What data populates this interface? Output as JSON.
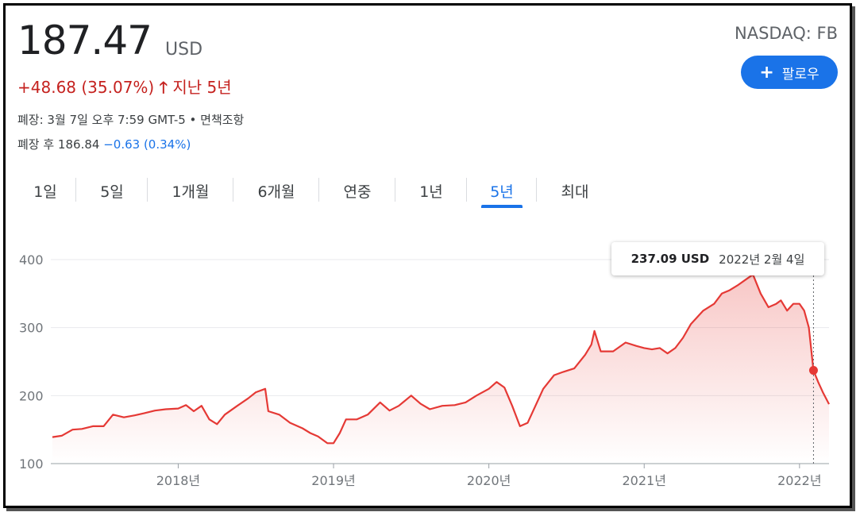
{
  "quote": {
    "price": "187.47",
    "currency": "USD",
    "change": "+48.68 (35.07%)",
    "change_arrow": "🡑",
    "change_period": "지난 5년",
    "closed_info": "폐장: 3월 7일 오후 7:59 GMT-5 • 면책조항",
    "after_label": "폐장 후 186.84",
    "after_change": "−0.63 (0.34%)",
    "ticker": "NASDAQ: FB",
    "follow_icon": "+",
    "follow_label": "팔로우"
  },
  "tabs": [
    "1일",
    "5일",
    "1개월",
    "6개월",
    "연중",
    "1년",
    "5년",
    "최대"
  ],
  "active_tab": "5년",
  "tooltip": {
    "value": "237.09 USD",
    "date": "2022년 2월 4일"
  },
  "colors": {
    "line": "#e53935",
    "accent": "#1a73e8",
    "negative": "#c5221f"
  },
  "chart_data": {
    "type": "area",
    "title": "",
    "xlabel": "",
    "ylabel": "",
    "ylim": [
      100,
      400
    ],
    "yticks": [
      100,
      200,
      300,
      400
    ],
    "xticks": [
      {
        "x": 2018.0,
        "label": "2018년"
      },
      {
        "x": 2019.0,
        "label": "2019년"
      },
      {
        "x": 2020.0,
        "label": "2020년"
      },
      {
        "x": 2021.0,
        "label": "2021년"
      },
      {
        "x": 2022.0,
        "label": "2022년"
      }
    ],
    "xlim": [
      2017.19,
      2022.19
    ],
    "grid": true,
    "highlight": {
      "x": 2022.09,
      "y": 237.09
    },
    "series": [
      {
        "values": [
          [
            2017.19,
            139
          ],
          [
            2017.25,
            141
          ],
          [
            2017.32,
            150
          ],
          [
            2017.38,
            151
          ],
          [
            2017.45,
            155
          ],
          [
            2017.52,
            155
          ],
          [
            2017.58,
            172
          ],
          [
            2017.65,
            168
          ],
          [
            2017.72,
            171
          ],
          [
            2017.78,
            174
          ],
          [
            2017.85,
            178
          ],
          [
            2017.92,
            180
          ],
          [
            2018.0,
            181
          ],
          [
            2018.05,
            186
          ],
          [
            2018.1,
            177
          ],
          [
            2018.15,
            185
          ],
          [
            2018.2,
            165
          ],
          [
            2018.25,
            158
          ],
          [
            2018.3,
            172
          ],
          [
            2018.38,
            185
          ],
          [
            2018.45,
            196
          ],
          [
            2018.5,
            205
          ],
          [
            2018.56,
            210
          ],
          [
            2018.58,
            177
          ],
          [
            2018.65,
            172
          ],
          [
            2018.72,
            160
          ],
          [
            2018.8,
            152
          ],
          [
            2018.85,
            145
          ],
          [
            2018.9,
            140
          ],
          [
            2018.96,
            130
          ],
          [
            2019.0,
            130
          ],
          [
            2019.04,
            145
          ],
          [
            2019.08,
            165
          ],
          [
            2019.15,
            165
          ],
          [
            2019.22,
            172
          ],
          [
            2019.3,
            190
          ],
          [
            2019.36,
            178
          ],
          [
            2019.42,
            185
          ],
          [
            2019.5,
            200
          ],
          [
            2019.56,
            188
          ],
          [
            2019.62,
            180
          ],
          [
            2019.7,
            185
          ],
          [
            2019.78,
            186
          ],
          [
            2019.85,
            190
          ],
          [
            2019.92,
            200
          ],
          [
            2020.0,
            210
          ],
          [
            2020.05,
            220
          ],
          [
            2020.1,
            212
          ],
          [
            2020.15,
            185
          ],
          [
            2020.2,
            155
          ],
          [
            2020.25,
            160
          ],
          [
            2020.3,
            185
          ],
          [
            2020.35,
            210
          ],
          [
            2020.42,
            230
          ],
          [
            2020.48,
            235
          ],
          [
            2020.55,
            240
          ],
          [
            2020.62,
            260
          ],
          [
            2020.66,
            275
          ],
          [
            2020.68,
            295
          ],
          [
            2020.72,
            265
          ],
          [
            2020.8,
            265
          ],
          [
            2020.88,
            278
          ],
          [
            2020.95,
            273
          ],
          [
            2021.0,
            270
          ],
          [
            2021.05,
            268
          ],
          [
            2021.1,
            270
          ],
          [
            2021.15,
            262
          ],
          [
            2021.2,
            270
          ],
          [
            2021.25,
            285
          ],
          [
            2021.3,
            305
          ],
          [
            2021.38,
            325
          ],
          [
            2021.45,
            335
          ],
          [
            2021.5,
            350
          ],
          [
            2021.55,
            355
          ],
          [
            2021.6,
            362
          ],
          [
            2021.65,
            370
          ],
          [
            2021.7,
            378
          ],
          [
            2021.75,
            350
          ],
          [
            2021.8,
            330
          ],
          [
            2021.85,
            335
          ],
          [
            2021.88,
            340
          ],
          [
            2021.92,
            325
          ],
          [
            2021.96,
            335
          ],
          [
            2022.0,
            335
          ],
          [
            2022.03,
            325
          ],
          [
            2022.06,
            300
          ],
          [
            2022.09,
            237.09
          ],
          [
            2022.12,
            220
          ],
          [
            2022.15,
            205
          ],
          [
            2022.19,
            187.47
          ]
        ]
      }
    ]
  }
}
